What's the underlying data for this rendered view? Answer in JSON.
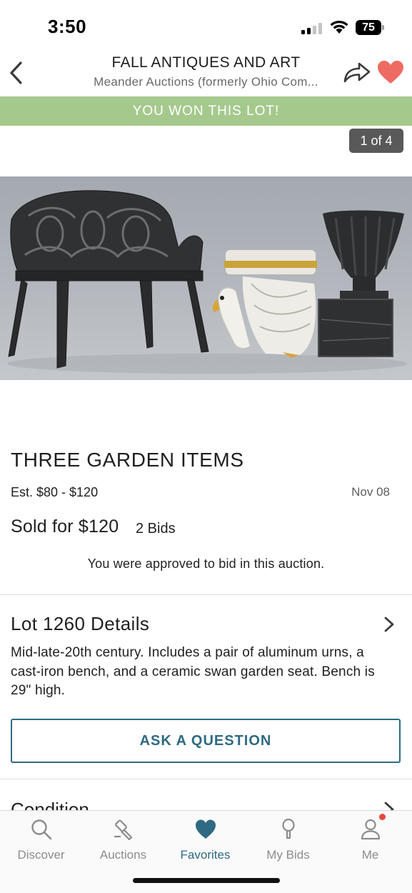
{
  "status_bar": {
    "time": "3:50",
    "battery": "75"
  },
  "header": {
    "title": "FALL ANTIQUES AND ART",
    "subtitle": "Meander Auctions (formerly Ohio Com...",
    "back_icon": "chevron-left-icon",
    "share_icon": "share-arrow-icon",
    "favorite_icon": "heart-icon",
    "favorite_color": "#ee6b63"
  },
  "banner": {
    "text": "YOU WON THIS LOT!",
    "color": "#a5c98d"
  },
  "photo": {
    "counter": "1 of 4",
    "description_icon": "lot-photo"
  },
  "lot": {
    "title": "THREE GARDEN ITEMS",
    "estimate": "Est. $80 - $120",
    "date": "Nov 08",
    "sold_for": "Sold for $120",
    "bids": "2 Bids",
    "approval_note": "You were approved to bid in this auction."
  },
  "details": {
    "title": "Lot 1260 Details",
    "description": "Mid-late-20th century. Includes a pair of aluminum urns, a cast-iron bench, and a ceramic swan garden seat. Bench is 29\" high."
  },
  "ask_button": {
    "label": "ASK A QUESTION",
    "color": "#2e6a82"
  },
  "condition": {
    "title": "Condition"
  },
  "tab_bar": {
    "active_color": "#2e6a82",
    "tabs": [
      {
        "label": "Discover",
        "icon": "search-icon"
      },
      {
        "label": "Auctions",
        "icon": "gavel-icon"
      },
      {
        "label": "Favorites",
        "icon": "heart-icon",
        "active": true
      },
      {
        "label": "My Bids",
        "icon": "paddle-icon"
      },
      {
        "label": "Me",
        "icon": "person-icon",
        "notification": true
      }
    ]
  }
}
